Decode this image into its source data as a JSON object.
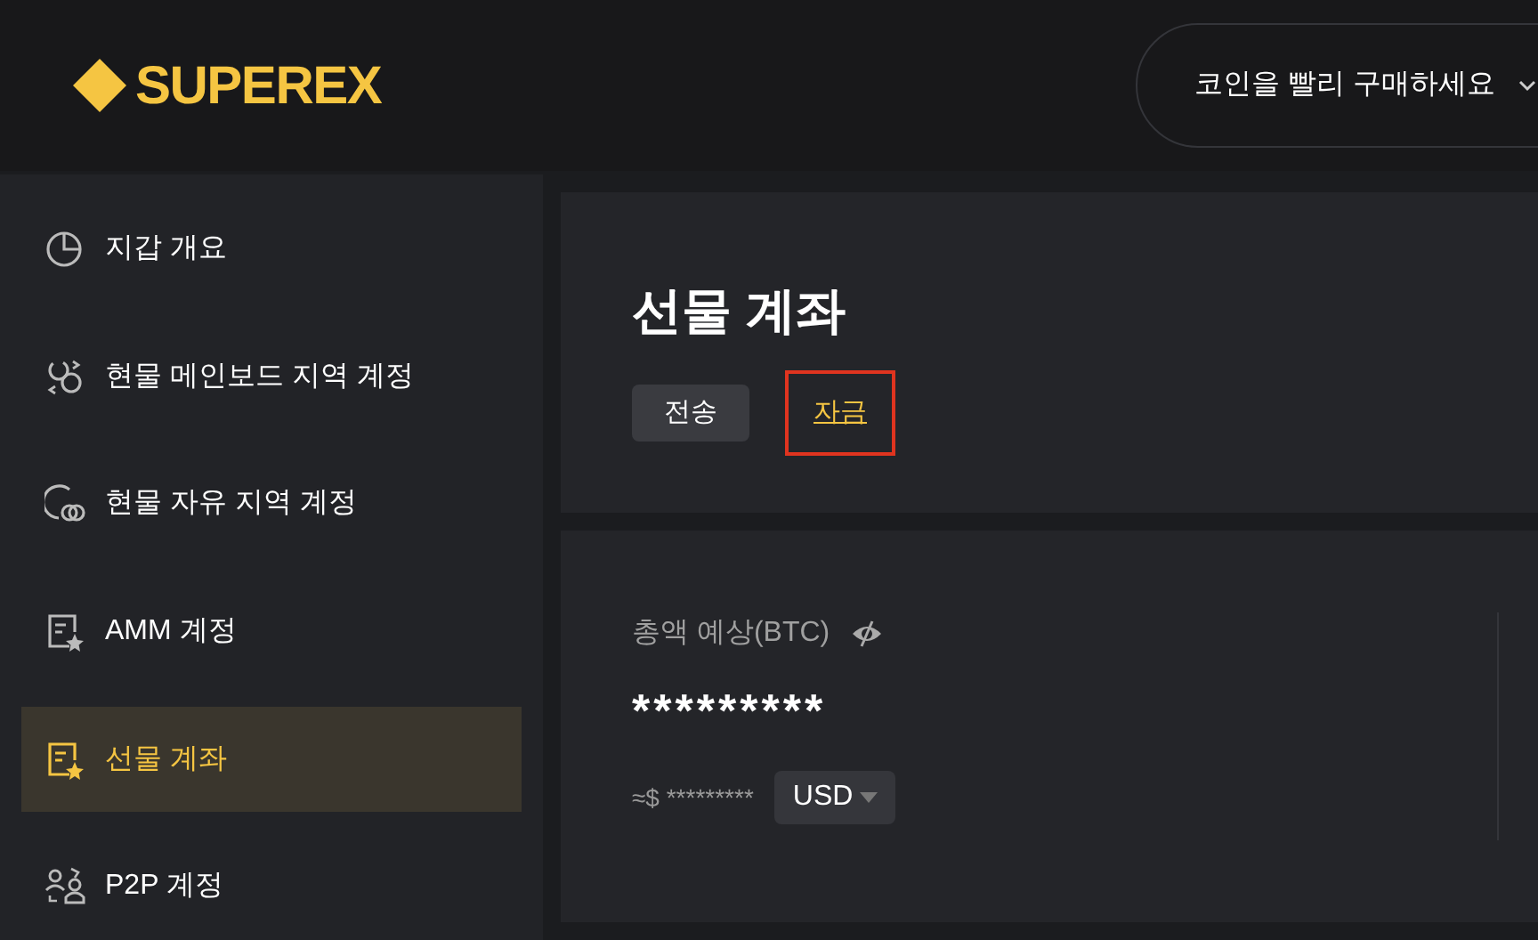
{
  "header": {
    "logo": "SUPEREX",
    "quick_buy": "코인을 빨리 구매하세요"
  },
  "sidebar": {
    "items": [
      {
        "label": "지갑 개요",
        "kind": "pie",
        "selected": false
      },
      {
        "label": "현물 메인보드 지역 계정",
        "kind": "exchange",
        "selected": false
      },
      {
        "label": "현물 자유 지역 계정",
        "kind": "coins",
        "selected": false
      },
      {
        "label": "AMM 계정",
        "kind": "doc-star",
        "selected": false
      },
      {
        "label": "선물 계좌",
        "kind": "doc-star",
        "selected": true
      },
      {
        "label": "P2P 계정",
        "kind": "users",
        "selected": false
      }
    ]
  },
  "account": {
    "title": "선물 계좌",
    "actions": [
      {
        "label": "전송",
        "kind": "button",
        "highlighted": false
      },
      {
        "label": "자금",
        "kind": "link",
        "highlighted": true
      }
    ]
  },
  "balance": {
    "label": "총액 예상(BTC)",
    "amount": "*********",
    "approx": "≈$ *********",
    "currency": "USD"
  }
}
